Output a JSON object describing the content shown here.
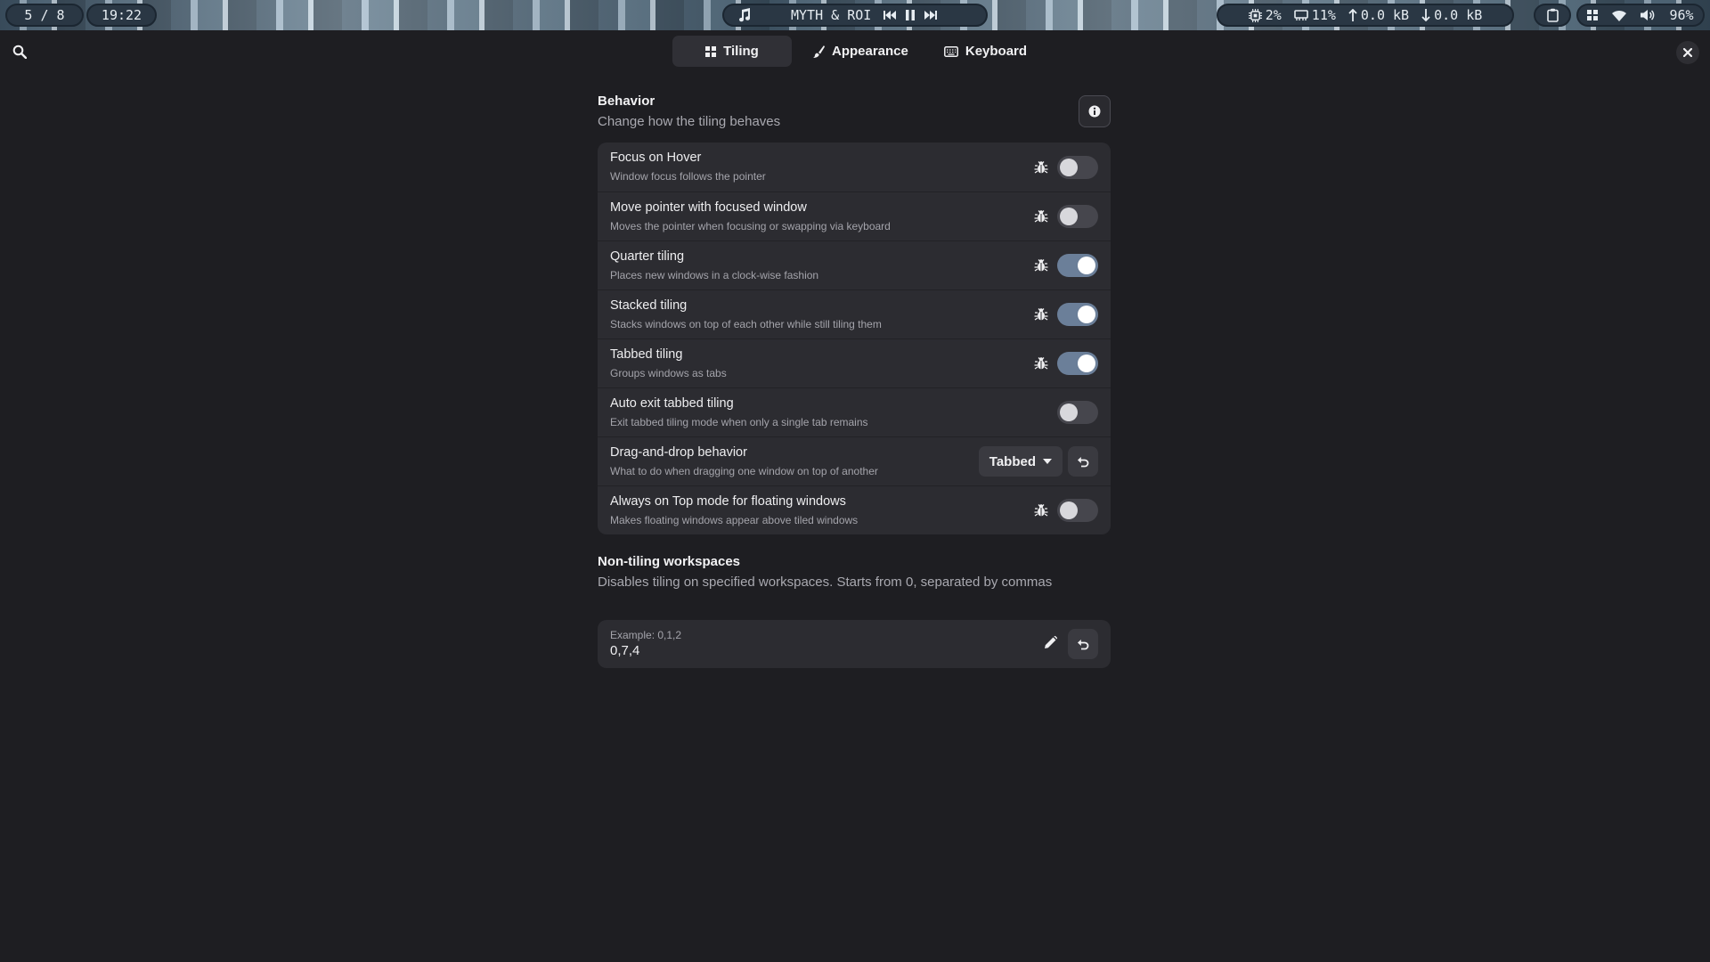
{
  "topbar": {
    "workspace": "5 / 8",
    "clock": "19:22",
    "media": {
      "title": "MYTH & ROI"
    },
    "stats": {
      "cpu": "2%",
      "memory": "11%",
      "upload": "0.0 kB",
      "download": "0.0 kB"
    },
    "battery": "96%"
  },
  "tabs": [
    {
      "label": "Tiling",
      "icon": "grid-icon",
      "active": true
    },
    {
      "label": "Appearance",
      "icon": "brush-icon",
      "active": false
    },
    {
      "label": "Keyboard",
      "icon": "keyboard-icon",
      "active": false
    }
  ],
  "behavior": {
    "title": "Behavior",
    "subtitle": "Change how the tiling behaves",
    "rows": [
      {
        "label": "Focus on Hover",
        "desc": "Window focus follows the pointer",
        "bug": true,
        "on": false
      },
      {
        "label": "Move pointer with focused window",
        "desc": "Moves the pointer when focusing or swapping via keyboard",
        "bug": true,
        "on": false
      },
      {
        "label": "Quarter tiling",
        "desc": "Places new windows in a clock-wise fashion",
        "bug": true,
        "on": true
      },
      {
        "label": "Stacked tiling",
        "desc": "Stacks windows on top of each other while still tiling them",
        "bug": true,
        "on": true
      },
      {
        "label": "Tabbed tiling",
        "desc": "Groups windows as tabs",
        "bug": true,
        "on": true
      },
      {
        "label": "Auto exit tabbed tiling",
        "desc": "Exit tabbed tiling mode when only a single tab remains",
        "bug": false,
        "on": false
      },
      {
        "label": "Drag-and-drop behavior",
        "desc": "What to do when dragging one window on top of another",
        "dropdown": "Tabbed"
      },
      {
        "label": "Always on Top mode for floating windows",
        "desc": "Makes floating windows appear above tiled windows",
        "bug": true,
        "on": false
      }
    ]
  },
  "non_tiling": {
    "title": "Non-tiling workspaces",
    "subtitle": "Disables tiling on specified workspaces. Starts from 0, separated by commas",
    "placeholder": "Example: 0,1,2",
    "value": "0,7,4"
  }
}
